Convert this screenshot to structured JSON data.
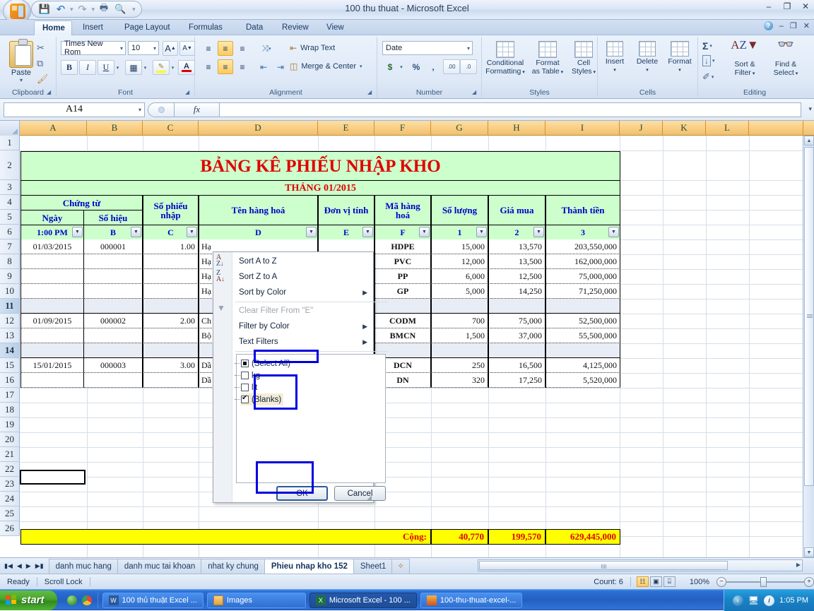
{
  "window": {
    "title": "100 thu thuat - Microsoft Excel",
    "minimize": "–",
    "maximize": "❐",
    "close": "✕",
    "ribbon_minimize": "–",
    "ribbon_maximize": "❐",
    "ribbon_close": "✕",
    "help": "?"
  },
  "qat": {
    "save": "💾",
    "undo": "↶",
    "undo_caret": "▾",
    "redo": "↷",
    "redo_caret": "▾",
    "print": "🖨",
    "print_preview": "🔍",
    "customize": "☰"
  },
  "tabs": [
    {
      "label": "Home",
      "active": true
    },
    {
      "label": "Insert",
      "active": false
    },
    {
      "label": "Page Layout",
      "active": false
    },
    {
      "label": "Formulas",
      "active": false
    },
    {
      "label": "Data",
      "active": false
    },
    {
      "label": "Review",
      "active": false
    },
    {
      "label": "View",
      "active": false
    }
  ],
  "ribbon": {
    "groups": [
      "Clipboard",
      "Font",
      "Alignment",
      "Number",
      "Styles",
      "Cells",
      "Editing"
    ],
    "clipboard": {
      "paste": "Paste",
      "paste_caret": "▾",
      "cut": "✂",
      "copy": "⧉",
      "format_painter": "🖌"
    },
    "font": {
      "font_name": "Times New Rom",
      "font_size": "10",
      "grow": "A",
      "shrink": "A",
      "bold": "B",
      "italic": "I",
      "underline": "U",
      "borders": "▦",
      "fill_color": "A",
      "font_color": "A",
      "caret": "▾"
    },
    "alignment": {
      "top_align": "≡",
      "middle_align": "≡",
      "bottom_align": "≡",
      "orientation": "⤨",
      "align_left": "≡",
      "align_center": "≡",
      "align_right": "≡",
      "decrease_indent": "⇤",
      "increase_indent": "⇥",
      "wrap_text": "Wrap Text",
      "merge_center": "Merge & Center",
      "caret": "▾"
    },
    "number": {
      "format": "Date",
      "caret": "▾",
      "currency": "$",
      "percent": "%",
      "comma": ",",
      "increase_decimal": ".00",
      "decrease_decimal": ".0"
    },
    "styles": {
      "conditional_formatting": "Conditional\nFormatting",
      "conditional_formatting_l1": "Conditional",
      "conditional_formatting_l2": "Formatting",
      "format_as_table_l1": "Format",
      "format_as_table_l2": "as Table",
      "cell_styles_l1": "Cell",
      "cell_styles_l2": "Styles",
      "caret": "▾"
    },
    "cells": {
      "insert": "Insert",
      "delete": "Delete",
      "format": "Format",
      "caret": "▾"
    },
    "editing": {
      "autosum": "Σ",
      "fill": "↓",
      "clear": "✐",
      "sort_filter_l1": "Sort &",
      "sort_filter_l2": "Filter",
      "find_select_l1": "Find &",
      "find_select_l2": "Select",
      "caret": "▾"
    }
  },
  "formula_bar": {
    "name_box": "A14",
    "name_box_caret": "▾",
    "insert_function": "fx",
    "formula_value": "",
    "expand_caret": "▾"
  },
  "grid": {
    "columns": [
      "A",
      "B",
      "C",
      "D",
      "E",
      "F",
      "G",
      "H",
      "I",
      "J",
      "K",
      "L"
    ],
    "rows": [
      "1",
      "2",
      "3",
      "4",
      "5",
      "6",
      "7",
      "8",
      "9",
      "10",
      "11",
      "12",
      "13",
      "14",
      "15",
      "16",
      "17",
      "18",
      "19",
      "20",
      "21",
      "22",
      "23",
      "24",
      "25",
      "26"
    ],
    "selected_cell": "A14",
    "selected_rows": [
      "11",
      "14"
    ],
    "filter_caret": "▼"
  },
  "sheet_table": {
    "title": "BẢNG KÊ PHIẾU NHẬP KHO",
    "subtitle": "THÁNG 01/2015",
    "headers_row4": [
      "Chứng từ",
      "Số phiếu nhập",
      "Tên hàng hoá",
      "Đơn vị tính",
      "Mã hàng hoá",
      "Số lượng",
      "Giá mua",
      "Thành tiền"
    ],
    "headers_row5": [
      "Ngày",
      "Số hiệu"
    ],
    "header_row4_merged": {
      "chungtu": "Chứng từ",
      "sophieu": "Số phiếu\nnhập",
      "sophieu_l1": "Số phiếu",
      "sophieu_l2": "nhập",
      "tenhang": "Tên hàng hoá",
      "donvi": "Đơn vị tính",
      "mahang_l1": "Mã hàng",
      "mahang_l2": "hoá",
      "soluong": "Số lượng",
      "giamua": "Giá mua",
      "thanhtien": "Thành tiền"
    },
    "filter_row": [
      "1:00 PM",
      "B",
      "C",
      "D",
      "E",
      "F",
      "1",
      "2",
      "3"
    ],
    "rows": [
      {
        "row": "7",
        "ngay": "01/03/2015",
        "sohieu": "000001",
        "sophieu": "1.00",
        "tenhang": "Hạ",
        "donvi": "",
        "mahang": "HDPE",
        "soluong": "15,000",
        "giamua": "13,570",
        "thanhtien": "203,550,000",
        "blank": false
      },
      {
        "row": "8",
        "ngay": "",
        "sohieu": "",
        "sophieu": "",
        "tenhang": "Hạ",
        "donvi": "",
        "mahang": "PVC",
        "soluong": "12,000",
        "giamua": "13,500",
        "thanhtien": "162,000,000",
        "blank": false
      },
      {
        "row": "9",
        "ngay": "",
        "sohieu": "",
        "sophieu": "",
        "tenhang": "Hạ",
        "donvi": "",
        "mahang": "PP",
        "soluong": "6,000",
        "giamua": "12,500",
        "thanhtien": "75,000,000",
        "blank": false
      },
      {
        "row": "10",
        "ngay": "",
        "sohieu": "",
        "sophieu": "",
        "tenhang": "Hạ",
        "donvi": "",
        "mahang": "GP",
        "soluong": "5,000",
        "giamua": "14,250",
        "thanhtien": "71,250,000",
        "blank": false
      },
      {
        "row": "11",
        "ngay": "",
        "sohieu": "",
        "sophieu": "",
        "tenhang": "",
        "donvi": "",
        "mahang": "",
        "soluong": "",
        "giamua": "",
        "thanhtien": "",
        "blank": true
      },
      {
        "row": "12",
        "ngay": "01/09/2015",
        "sohieu": "000002",
        "sophieu": "2.00",
        "tenhang": "Ch",
        "donvi": "",
        "mahang": "CODM",
        "soluong": "700",
        "giamua": "75,000",
        "thanhtien": "52,500,000",
        "blank": false
      },
      {
        "row": "13",
        "ngay": "",
        "sohieu": "",
        "sophieu": "",
        "tenhang": "Bộ",
        "donvi": "",
        "mahang": "BMCN",
        "soluong": "1,500",
        "giamua": "37,000",
        "thanhtien": "55,500,000",
        "blank": false
      },
      {
        "row": "14",
        "ngay": "",
        "sohieu": "",
        "sophieu": "",
        "tenhang": "",
        "donvi": "",
        "mahang": "",
        "soluong": "",
        "giamua": "",
        "thanhtien": "",
        "blank": true
      },
      {
        "row": "15",
        "ngay": "15/01/2015",
        "sohieu": "000003",
        "sophieu": "3.00",
        "tenhang": "Dầ",
        "donvi": "",
        "mahang": "DCN",
        "soluong": "250",
        "giamua": "16,500",
        "thanhtien": "4,125,000",
        "blank": false
      },
      {
        "row": "16",
        "ngay": "",
        "sohieu": "",
        "sophieu": "",
        "tenhang": "Dầ",
        "donvi": "",
        "mahang": "DN",
        "soluong": "320",
        "giamua": "17,250",
        "thanhtien": "5,520,000",
        "blank": false
      }
    ],
    "total": {
      "label": "Cộng:",
      "soluong": "40,770",
      "giamua": "199,570",
      "thanhtien": "629,445,000"
    }
  },
  "filter_menu": {
    "items": [
      {
        "label": "Sort A to Z",
        "icon": "sort-az-icon",
        "submenu": false,
        "disabled": false
      },
      {
        "label": "Sort Z to A",
        "icon": "sort-za-icon",
        "submenu": false,
        "disabled": false
      },
      {
        "label": "Sort by Color",
        "icon": "",
        "submenu": true,
        "disabled": false
      },
      {
        "label": "Clear Filter From \"E\"",
        "icon": "clear-filter-icon",
        "submenu": false,
        "disabled": true
      },
      {
        "label": "Filter by Color",
        "icon": "",
        "submenu": true,
        "disabled": false
      },
      {
        "label": "Text Filters",
        "icon": "",
        "submenu": true,
        "disabled": false
      }
    ],
    "submenu_arrow": "▶",
    "checklist": [
      {
        "label": "(Select All)",
        "state": "mixed"
      },
      {
        "label": "kg",
        "state": "off"
      },
      {
        "label": "lit",
        "state": "off"
      },
      {
        "label": "(Blanks)",
        "state": "on"
      }
    ],
    "ok": "OK",
    "cancel": "Cancel"
  },
  "sheet_tabs": {
    "nav_first": "⏮",
    "nav_prev": "◀",
    "nav_next": "▶",
    "nav_last": "⏭",
    "items": [
      {
        "label": "danh muc hang",
        "active": false
      },
      {
        "label": "danh muc tai khoan",
        "active": false
      },
      {
        "label": "nhat ky chung",
        "active": false
      },
      {
        "label": "Phieu nhap kho 152",
        "active": true
      },
      {
        "label": "Sheet1",
        "active": false
      }
    ],
    "insert_sheet": "➕"
  },
  "status_bar": {
    "mode": "Ready",
    "scroll_lock": "Scroll Lock",
    "count": "Count: 6",
    "view_normal": "☷",
    "view_layout": "▣",
    "view_pagebreak": "⌸",
    "zoom": "100%",
    "zoom_out": "−",
    "zoom_in": "+"
  },
  "taskbar": {
    "start": "start",
    "quick_launch": [
      "media-player-icon",
      "chrome-icon"
    ],
    "items": [
      {
        "label": "100 thủ thuật Excel ...",
        "icon": "word-icon",
        "active": false
      },
      {
        "label": "Images",
        "icon": "folder-icon",
        "active": false
      },
      {
        "label": "Microsoft Excel - 100 ...",
        "icon": "excel-icon",
        "active": true
      },
      {
        "label": "100-thu-thuat-excel-...",
        "icon": "paint-icon",
        "active": false
      }
    ],
    "tray_time": "1:05 PM",
    "tray_show_hidden": "‹",
    "tray_network": "🖧",
    "tray_info": "i"
  }
}
